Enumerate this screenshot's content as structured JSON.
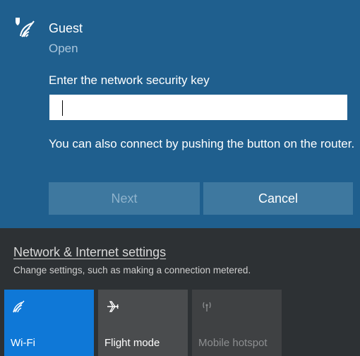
{
  "network": {
    "ssid": "Guest",
    "status": "Open",
    "prompt": "Enter the network security key",
    "key_value": "",
    "wps_hint": "You can also connect by pushing the button on the router.",
    "next_label": "Next",
    "cancel_label": "Cancel",
    "icon": "wifi-secured-icon"
  },
  "settings": {
    "link_label": "Network & Internet settings",
    "description": "Change settings, such as making a connection metered."
  },
  "quick_actions": [
    {
      "label": "Wi-Fi",
      "icon": "wifi-icon",
      "active": true
    },
    {
      "label": "Flight mode",
      "icon": "airplane-icon",
      "active": false
    },
    {
      "label": "Mobile hotspot",
      "icon": "hotspot-icon",
      "active": false,
      "disabled": true
    }
  ],
  "colors": {
    "accent": "#0f78d7",
    "panel_blue": "#1f5f8e",
    "button_blue": "#3e789f",
    "dark_bg": "#2d3134"
  }
}
